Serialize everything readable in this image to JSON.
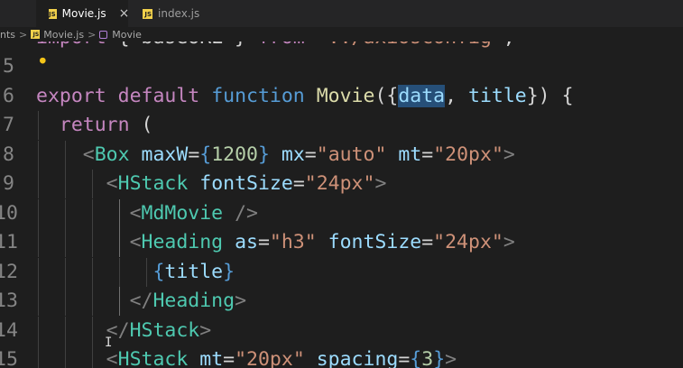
{
  "tabs": [
    {
      "label": "Movie.js",
      "active": true,
      "close": "×"
    },
    {
      "label": "index.js",
      "active": false
    }
  ],
  "file_badge": "JS",
  "breadcrumb": {
    "items": [
      "nts",
      "Movie.js",
      "Movie"
    ],
    "separator": ">"
  },
  "lines": [
    {
      "num": "",
      "tokens": [
        {
          "t": "import",
          "c": "kw-ctrl"
        },
        {
          "t": " { baseURL } ",
          "c": "plain"
        },
        {
          "t": "from",
          "c": "kw-ctrl"
        },
        {
          "t": " ",
          "c": "plain"
        },
        {
          "t": "\"../axiosconfig\"",
          "c": "str"
        },
        {
          "t": ";",
          "c": "plain"
        }
      ]
    },
    {
      "num": "5",
      "tokens": []
    },
    {
      "num": "6",
      "tokens": [
        {
          "t": "export",
          "c": "kw-ctrl"
        },
        {
          "t": " ",
          "c": "plain"
        },
        {
          "t": "default",
          "c": "kw-ctrl"
        },
        {
          "t": " ",
          "c": "plain"
        },
        {
          "t": "function",
          "c": "kw"
        },
        {
          "t": " ",
          "c": "plain"
        },
        {
          "t": "Movie",
          "c": "fn"
        },
        {
          "t": "({",
          "c": "plain"
        },
        {
          "t": "data",
          "c": "var",
          "hl": true
        },
        {
          "t": ", ",
          "c": "plain"
        },
        {
          "t": "title",
          "c": "var"
        },
        {
          "t": "}) {",
          "c": "plain"
        }
      ]
    },
    {
      "num": "7",
      "tokens": [
        {
          "t": "  ",
          "c": "plain"
        },
        {
          "t": "return",
          "c": "kw-ctrl"
        },
        {
          "t": " (",
          "c": "plain"
        }
      ]
    },
    {
      "num": "8",
      "tokens": [
        {
          "t": "    ",
          "c": "plain"
        },
        {
          "t": "<",
          "c": "punct-tag"
        },
        {
          "t": "Box",
          "c": "tag"
        },
        {
          "t": " ",
          "c": "plain"
        },
        {
          "t": "maxW",
          "c": "attr"
        },
        {
          "t": "=",
          "c": "plain"
        },
        {
          "t": "{",
          "c": "brace"
        },
        {
          "t": "1200",
          "c": "num"
        },
        {
          "t": "}",
          "c": "brace"
        },
        {
          "t": " ",
          "c": "plain"
        },
        {
          "t": "mx",
          "c": "attr"
        },
        {
          "t": "=",
          "c": "plain"
        },
        {
          "t": "\"auto\"",
          "c": "str"
        },
        {
          "t": " ",
          "c": "plain"
        },
        {
          "t": "mt",
          "c": "attr"
        },
        {
          "t": "=",
          "c": "plain"
        },
        {
          "t": "\"20px\"",
          "c": "str"
        },
        {
          "t": ">",
          "c": "punct-tag"
        }
      ]
    },
    {
      "num": "9",
      "tokens": [
        {
          "t": "      ",
          "c": "plain"
        },
        {
          "t": "<",
          "c": "punct-tag"
        },
        {
          "t": "HStack",
          "c": "tag"
        },
        {
          "t": " ",
          "c": "plain"
        },
        {
          "t": "fontSize",
          "c": "attr"
        },
        {
          "t": "=",
          "c": "plain"
        },
        {
          "t": "\"24px\"",
          "c": "str"
        },
        {
          "t": ">",
          "c": "punct-tag"
        }
      ]
    },
    {
      "num": "10",
      "tokens": [
        {
          "t": "        ",
          "c": "plain"
        },
        {
          "t": "<",
          "c": "punct-tag"
        },
        {
          "t": "MdMovie",
          "c": "tag"
        },
        {
          "t": " />",
          "c": "punct-tag"
        }
      ]
    },
    {
      "num": "11",
      "tokens": [
        {
          "t": "        ",
          "c": "plain"
        },
        {
          "t": "<",
          "c": "punct-tag"
        },
        {
          "t": "Heading",
          "c": "tag"
        },
        {
          "t": " ",
          "c": "plain"
        },
        {
          "t": "as",
          "c": "attr"
        },
        {
          "t": "=",
          "c": "plain"
        },
        {
          "t": "\"h3\"",
          "c": "str"
        },
        {
          "t": " ",
          "c": "plain"
        },
        {
          "t": "fontSize",
          "c": "attr"
        },
        {
          "t": "=",
          "c": "plain"
        },
        {
          "t": "\"24px\"",
          "c": "str"
        },
        {
          "t": ">",
          "c": "punct-tag"
        }
      ]
    },
    {
      "num": "12",
      "tokens": [
        {
          "t": "          ",
          "c": "plain"
        },
        {
          "t": "{",
          "c": "brace"
        },
        {
          "t": "title",
          "c": "var"
        },
        {
          "t": "}",
          "c": "brace"
        }
      ]
    },
    {
      "num": "13",
      "tokens": [
        {
          "t": "        ",
          "c": "plain"
        },
        {
          "t": "</",
          "c": "punct-tag"
        },
        {
          "t": "Heading",
          "c": "tag"
        },
        {
          "t": ">",
          "c": "punct-tag"
        }
      ]
    },
    {
      "num": "14",
      "tokens": [
        {
          "t": "      ",
          "c": "plain"
        },
        {
          "t": "</",
          "c": "punct-tag"
        },
        {
          "t": "HStack",
          "c": "tag"
        },
        {
          "t": ">",
          "c": "punct-tag"
        }
      ]
    },
    {
      "num": "15",
      "tokens": [
        {
          "t": "      ",
          "c": "plain"
        },
        {
          "t": "<",
          "c": "punct-tag"
        },
        {
          "t": "HStack",
          "c": "tag"
        },
        {
          "t": " ",
          "c": "plain"
        },
        {
          "t": "mt",
          "c": "attr"
        },
        {
          "t": "=",
          "c": "plain"
        },
        {
          "t": "\"20px\"",
          "c": "str"
        },
        {
          "t": " ",
          "c": "plain"
        },
        {
          "t": "spacing",
          "c": "attr"
        },
        {
          "t": "=",
          "c": "plain"
        },
        {
          "t": "{",
          "c": "brace"
        },
        {
          "t": "3",
          "c": "num"
        },
        {
          "t": "}",
          "c": "brace"
        },
        {
          "t": ">",
          "c": "punct-tag"
        }
      ]
    }
  ]
}
